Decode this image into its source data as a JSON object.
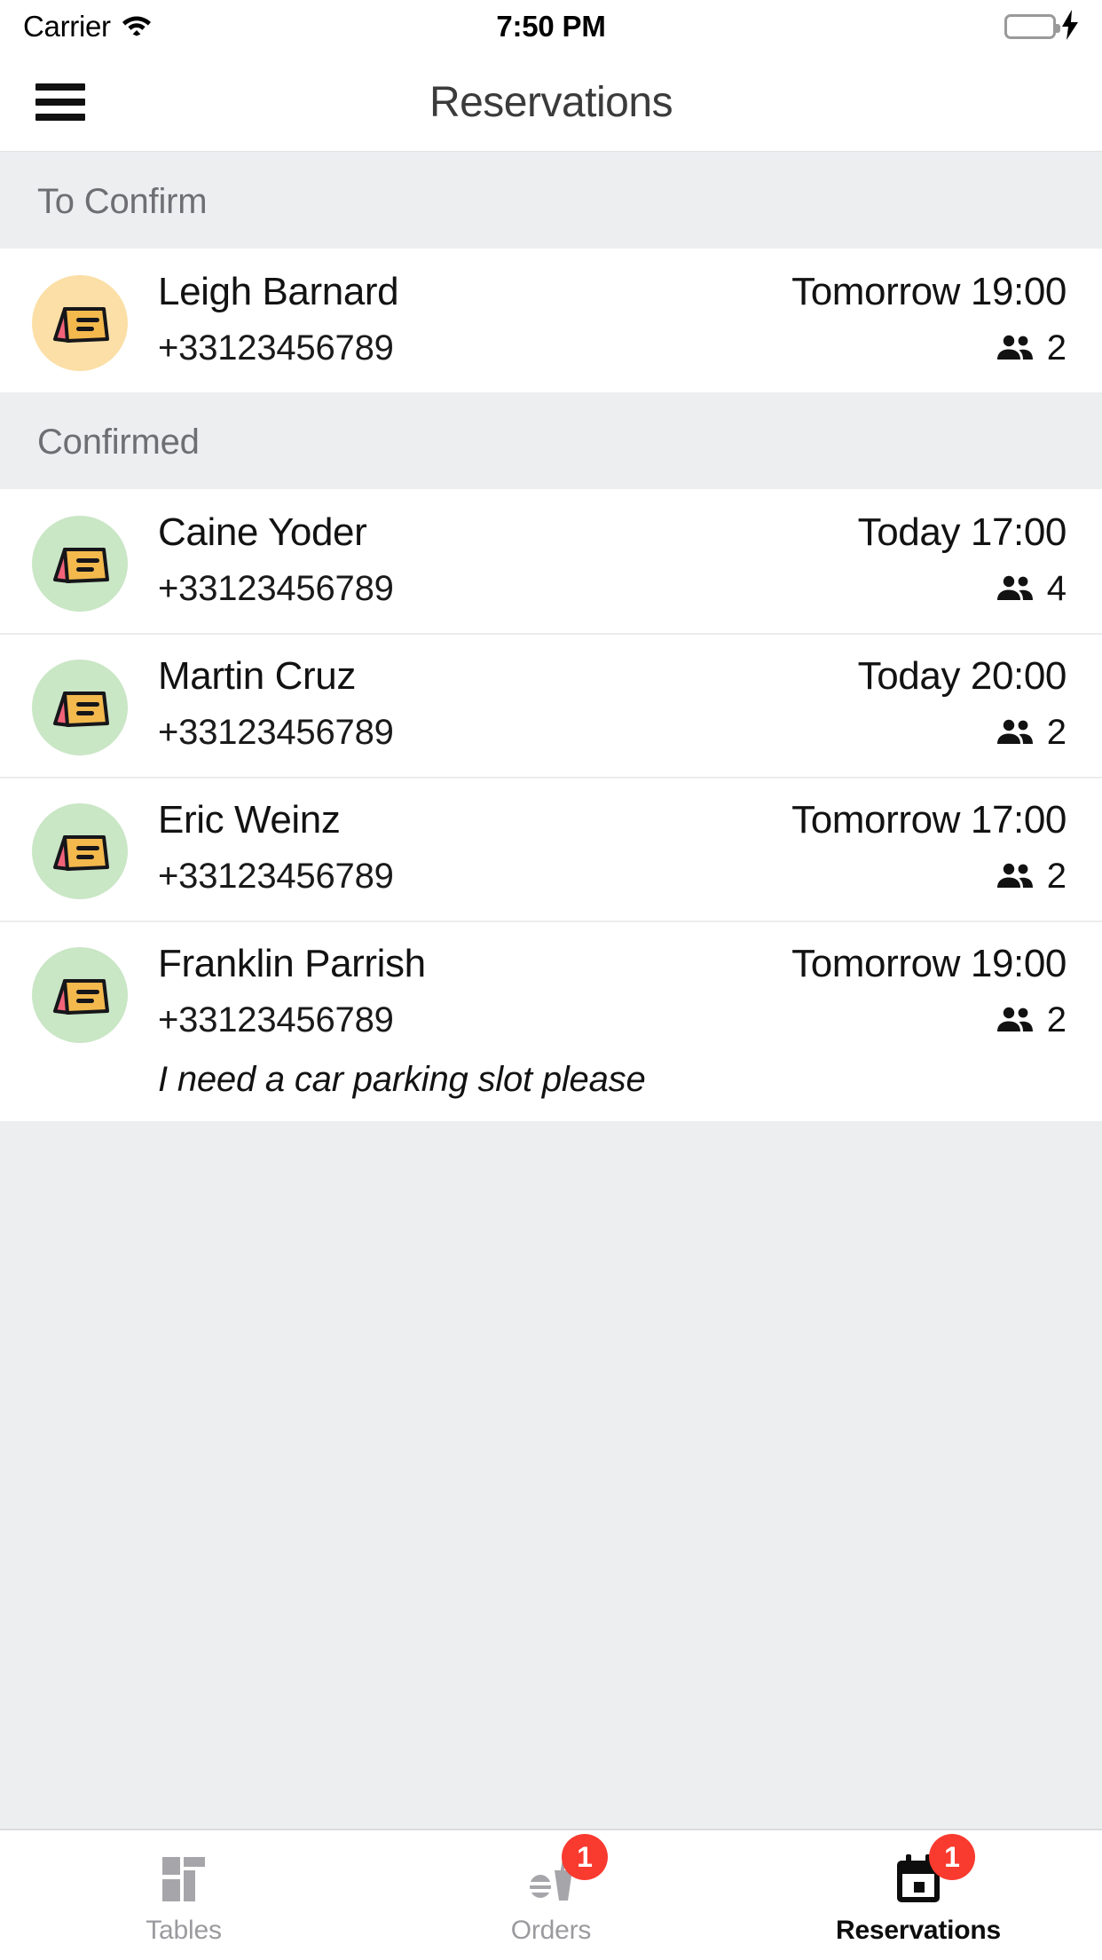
{
  "status_bar": {
    "carrier": "Carrier",
    "time": "7:50 PM",
    "wifi_icon": "wifi-icon",
    "battery_icon": "battery-icon",
    "charging_icon": "lightning-bolt-icon",
    "battery_color": "#4cd964"
  },
  "nav": {
    "menu_icon": "hamburger-menu-icon",
    "title": "Reservations"
  },
  "colors": {
    "pending_avatar": "#fbdfa6",
    "confirmed_avatar": "#c9e6c5",
    "badge_red": "#f93a2f",
    "section_bg": "#eceef0",
    "card_front": "#f3b94d",
    "card_side": "#f2637a"
  },
  "sections": [
    {
      "title": "To Confirm",
      "status": "pending",
      "rows": [
        {
          "avatar_icon": "table-tent-card-icon",
          "name": "Leigh Barnard",
          "phone": "+33123456789",
          "time": "Tomorrow 19:00",
          "party_icon": "people-icon",
          "party_size": "2",
          "note": ""
        }
      ]
    },
    {
      "title": "Confirmed",
      "status": "confirmed",
      "rows": [
        {
          "avatar_icon": "table-tent-card-icon",
          "name": "Caine Yoder",
          "phone": "+33123456789",
          "time": "Today 17:00",
          "party_icon": "people-icon",
          "party_size": "4",
          "note": ""
        },
        {
          "avatar_icon": "table-tent-card-icon",
          "name": "Martin Cruz",
          "phone": "+33123456789",
          "time": "Today 20:00",
          "party_icon": "people-icon",
          "party_size": "2",
          "note": ""
        },
        {
          "avatar_icon": "table-tent-card-icon",
          "name": "Eric Weinz",
          "phone": "+33123456789",
          "time": "Tomorrow 17:00",
          "party_icon": "people-icon",
          "party_size": "2",
          "note": ""
        },
        {
          "avatar_icon": "table-tent-card-icon",
          "name": "Franklin Parrish",
          "phone": "+33123456789",
          "time": "Tomorrow 19:00",
          "party_icon": "people-icon",
          "party_size": "2",
          "note": "I need a car parking slot please"
        }
      ]
    }
  ],
  "tab_bar": {
    "tabs": [
      {
        "label": "Tables",
        "icon": "grid-dashboard-icon",
        "active": false,
        "badge": ""
      },
      {
        "label": "Orders",
        "icon": "food-drink-icon",
        "active": false,
        "badge": "1"
      },
      {
        "label": "Reservations",
        "icon": "calendar-icon",
        "active": true,
        "badge": "1"
      }
    ]
  }
}
